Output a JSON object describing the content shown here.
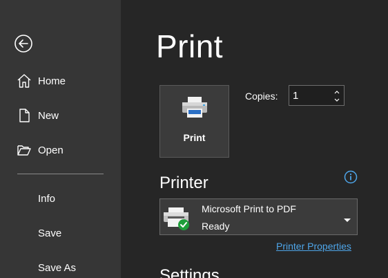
{
  "sidebar": {
    "back_icon": "back-arrow-icon",
    "items": [
      {
        "label": "Home",
        "icon": "home-icon"
      },
      {
        "label": "New",
        "icon": "new-document-icon"
      },
      {
        "label": "Open",
        "icon": "folder-open-icon"
      },
      {
        "label": "Info"
      },
      {
        "label": "Save"
      },
      {
        "label": "Save As"
      }
    ]
  },
  "main": {
    "title": "Print",
    "print_button": {
      "label": "Print",
      "icon": "printer-icon"
    },
    "copies": {
      "label": "Copies:",
      "value": "1"
    },
    "printer_section": {
      "heading": "Printer",
      "info_icon": "info-icon",
      "selected_printer": "Microsoft Print to PDF",
      "status": "Ready",
      "properties_link": "Printer Properties"
    },
    "settings_section": {
      "heading": "Settings"
    }
  },
  "colors": {
    "sidebar_bg": "#363636",
    "main_bg": "#262626",
    "accent_link": "#4ea6ea",
    "status_green": "#1e9e3a"
  }
}
